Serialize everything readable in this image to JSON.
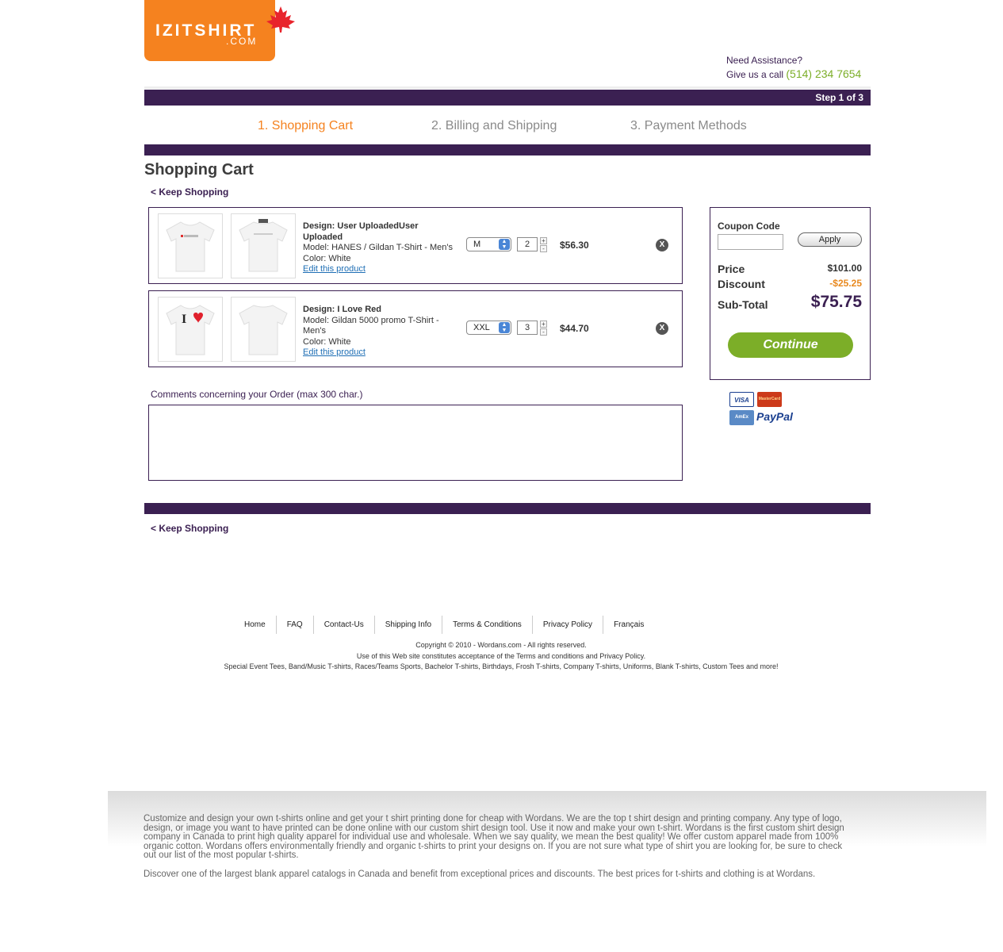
{
  "header": {
    "logo_main": "IZITSHIRT",
    "logo_sub": ".COM",
    "assist_line1": "Need Assistance?",
    "assist_line2": "Give us a call",
    "phone": "(514) 234 7654",
    "step_indicator": "Step 1 of 3"
  },
  "steps": [
    "1. Shopping Cart",
    "2. Billing and Shipping",
    "3. Payment Methods"
  ],
  "page_title": "Shopping Cart",
  "keep_shopping": "< Keep Shopping",
  "cart_items": [
    {
      "design": "Design: User UploadedUser Uploaded",
      "model": "Model: HANES / Gildan T-Shirt - Men's",
      "color": "Color: White",
      "edit": "Edit this product",
      "size": "M",
      "qty": "2",
      "price": "$56.30",
      "remove": "X",
      "front_text": "",
      "back_text": ""
    },
    {
      "design": "Design: I Love Red",
      "model": "Model: Gildan 5000 promo T-Shirt - Men's",
      "color": "Color: White",
      "edit": "Edit this product",
      "size": "XXL",
      "qty": "3",
      "price": "$44.70",
      "remove": "X",
      "front_text": "I"
    }
  ],
  "comments_label": "Comments concerning your Order (max 300 char.)",
  "summary": {
    "coupon_label": "Coupon Code",
    "coupon_value": "",
    "apply": "Apply",
    "price_label": "Price",
    "price_value": "$101.00",
    "discount_label": "Discount",
    "discount_value": "-$25.25",
    "subtotal_label": "Sub-Total",
    "subtotal_value": "$75.75",
    "continue": "Continue"
  },
  "payment_methods": [
    "VISA",
    "MasterCard",
    "AmEx",
    "PayPal"
  ],
  "footer": {
    "links": [
      "Home",
      "FAQ",
      "Contact-Us",
      "Shipping Info",
      "Terms & Conditions",
      "Privacy Policy",
      "Français"
    ],
    "copyright": "Copyright © 2010 - Wordans.com - All rights reserved.",
    "terms_note": "Use of this Web site constitutes acceptance of the Terms and conditions and Privacy Policy.",
    "categories": "Special Event Tees, Band/Music T-shirts, Races/Teams Sports, Bachelor T-shirts, Birthdays, Frosh T-shirts, Company T-shirts, Uniforms, Blank T-shirts, Custom Tees and more!",
    "seo_1": "Customize and design your own t-shirts online and get your t shirt printing done for cheap with Wordans. We are the top t shirt design and printing company. Any type of logo, design, or image you want to have printed can be done online with our custom shirt design tool. Use it now and make your own t-shirt. Wordans is the first custom shirt design company in Canada to print high quality apparel for individual use and wholesale. When we say quality, we mean the best quality! We offer custom apparel made from 100% organic cotton. Wordans offers environmentally friendly and organic t-shirts to print your designs on. If you are not sure what type of shirt you are looking for, be sure to check out our list of the most popular t-shirts.",
    "seo_2": "Discover one of the largest blank apparel catalogs in Canada and benefit from exceptional prices and discounts. The best prices for t-shirts and clothing is at Wordans."
  },
  "colors": {
    "brand_orange": "#f5821f",
    "brand_purple": "#3b2052",
    "accent_green": "#7cae28",
    "link_blue": "#1f6fb5"
  }
}
